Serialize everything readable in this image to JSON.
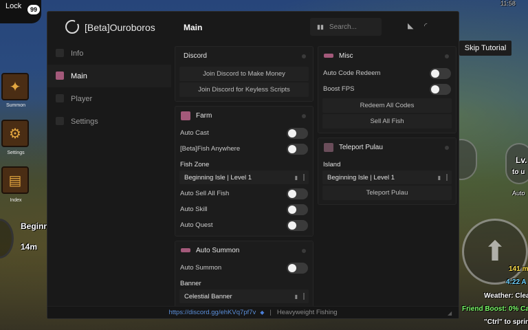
{
  "game": {
    "lock_label": "Lock",
    "lock_count": "99",
    "side_buttons": [
      "Summon",
      "Settings",
      "Index"
    ],
    "skip_tutorial": "Skip Tutorial",
    "location_text": "Beginn",
    "distance_text": "14m",
    "level_text": "Lv.",
    "level_sub": "to u",
    "auto_text": "Auto",
    "hud": {
      "count": "141 m",
      "time": "4:22 A",
      "weather": "Weather: Clea",
      "friend_boost": "Friend Boost: 0% Cas",
      "sprint_hint": "\"Ctrl\" to sprin"
    },
    "top_right_time": "11:58"
  },
  "window": {
    "app_title": "[Beta]Ouroboros",
    "page_title": "Main",
    "search_placeholder": "Search...",
    "nav": [
      {
        "label": "Info",
        "icon": "info-icon"
      },
      {
        "label": "Main",
        "icon": "main-icon"
      },
      {
        "label": "Player",
        "icon": "player-icon"
      },
      {
        "label": "Settings",
        "icon": "settings-icon"
      }
    ],
    "discord": {
      "title": "Discord",
      "buttons": [
        "Join Discord to Make Money",
        "Join Discord for Keyless Scripts"
      ]
    },
    "farm": {
      "title": "Farm",
      "toggles_top": [
        "Auto Cast",
        "[Beta]Fish Anywhere"
      ],
      "fish_zone_label": "Fish Zone",
      "fish_zone_value": "Beginning Isle | Level 1",
      "toggles_bottom": [
        "Auto Sell All Fish",
        "Auto Skill",
        "Auto Quest"
      ]
    },
    "auto_summon": {
      "title": "Auto Summon",
      "toggle": "Auto Summon",
      "banner_label": "Banner",
      "banner_value": "Celestial Banner"
    },
    "misc": {
      "title": "Misc",
      "toggles": [
        "Auto Code Redeem",
        "Boost FPS"
      ],
      "buttons": [
        "Redeem All Codes",
        "Sell All Fish"
      ]
    },
    "teleport": {
      "title": "Teleport Pulau",
      "island_label": "Island",
      "island_value": "Beginning Isle | Level 1",
      "button": "Teleport Pulau"
    },
    "footer": {
      "link": "https://discord.gg/ehKVq7pf7v",
      "separator": "|",
      "game_name": "Heavyweight Fishing"
    }
  }
}
